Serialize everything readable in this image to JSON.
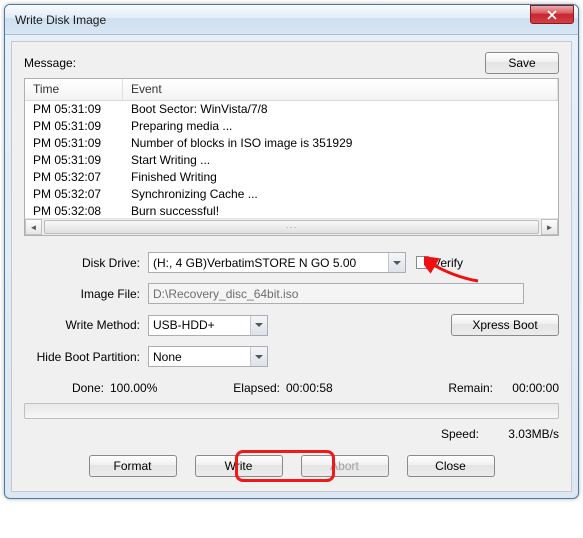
{
  "window": {
    "title": "Write Disk Image"
  },
  "labels": {
    "message": "Message:",
    "save": "Save",
    "col_time": "Time",
    "col_event": "Event",
    "disk_drive": "Disk Drive:",
    "verify": "Verify",
    "image_file": "Image File:",
    "write_method": "Write Method:",
    "xpress_boot": "Xpress Boot",
    "hide_boot_partition": "Hide Boot Partition:",
    "done": "Done:",
    "elapsed": "Elapsed:",
    "remain": "Remain:",
    "speed": "Speed:",
    "format": "Format",
    "write": "Write",
    "abort": "Abort",
    "close": "Close"
  },
  "log": [
    {
      "time": "PM 05:31:09",
      "event": "Boot Sector: WinVista/7/8"
    },
    {
      "time": "PM 05:31:09",
      "event": "Preparing media ..."
    },
    {
      "time": "PM 05:31:09",
      "event": "Number of blocks in ISO image is 351929"
    },
    {
      "time": "PM 05:31:09",
      "event": "Start Writing ..."
    },
    {
      "time": "PM 05:32:07",
      "event": "Finished Writing"
    },
    {
      "time": "PM 05:32:07",
      "event": "Synchronizing Cache ..."
    },
    {
      "time": "PM 05:32:08",
      "event": "Burn successful!"
    }
  ],
  "fields": {
    "disk_drive": "(H:, 4 GB)VerbatimSTORE N GO     5.00",
    "image_file": "D:\\Recovery_disc_64bit.iso",
    "write_method": "USB-HDD+",
    "hide_boot_partition": "None"
  },
  "status": {
    "done": "100.00%",
    "elapsed": "00:00:58",
    "remain": "00:00:00",
    "speed": "3.03MB/s"
  }
}
